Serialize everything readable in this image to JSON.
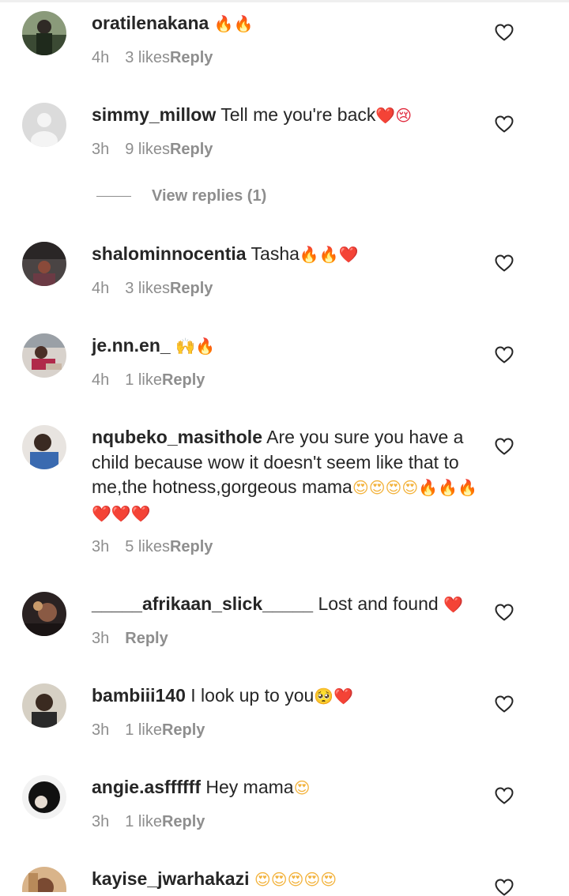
{
  "comments": [
    {
      "username": "oratilenakana",
      "text": "",
      "emoji": "🔥🔥",
      "time": "4h",
      "likes": "3 likes",
      "reply": "Reply",
      "avatar_color": "#2f3a2a"
    },
    {
      "username": "simmy_millow",
      "text": "Tell me you're back",
      "emoji": "❤️😢",
      "time": "3h",
      "likes": "9 likes",
      "reply": "Reply",
      "avatar_color": "#dcdcdc"
    },
    {
      "username": "shalominnocentia",
      "text": "Tasha",
      "emoji": "🔥🔥❤️",
      "time": "4h",
      "likes": "3 likes",
      "reply": "Reply",
      "avatar_color": "#3a3030"
    },
    {
      "username": "je.nn.en_",
      "text": "",
      "emoji": "🙌🔥",
      "time": "4h",
      "likes": "1 like",
      "reply": "Reply",
      "avatar_color": "#6d5a52"
    },
    {
      "username": "nqubeko_masithole",
      "text": "Are you sure you have a child because wow it doesn't seem like that to me,the hotness,gorgeous mama",
      "emoji": "😍😍😍😍🔥🔥🔥❤️❤️❤️",
      "time": "3h",
      "likes": "5 likes",
      "reply": "Reply",
      "avatar_color": "#5b6d86"
    },
    {
      "username": "_____afrikaan_slick_____",
      "text": "Lost and found",
      "emoji": "❤️",
      "time": "3h",
      "likes": "",
      "reply": "Reply",
      "avatar_color": "#3a2c2c"
    },
    {
      "username": "bambiii140",
      "text": "I look up to you",
      "emoji": "🥺❤️",
      "time": "3h",
      "likes": "1 like",
      "reply": "Reply",
      "avatar_color": "#4a4036"
    },
    {
      "username": "angie.asffffff",
      "text": "Hey mama",
      "emoji": "😍",
      "time": "3h",
      "likes": "1 like",
      "reply": "Reply",
      "avatar_color": "#1a1a1a"
    },
    {
      "username": "kayise_jwarhakazi",
      "text": "",
      "emoji": "😍😍😍😍😍",
      "time": "",
      "likes": "",
      "reply": "",
      "avatar_color": "#6b4a3a"
    }
  ],
  "view_replies": "View replies (1)"
}
